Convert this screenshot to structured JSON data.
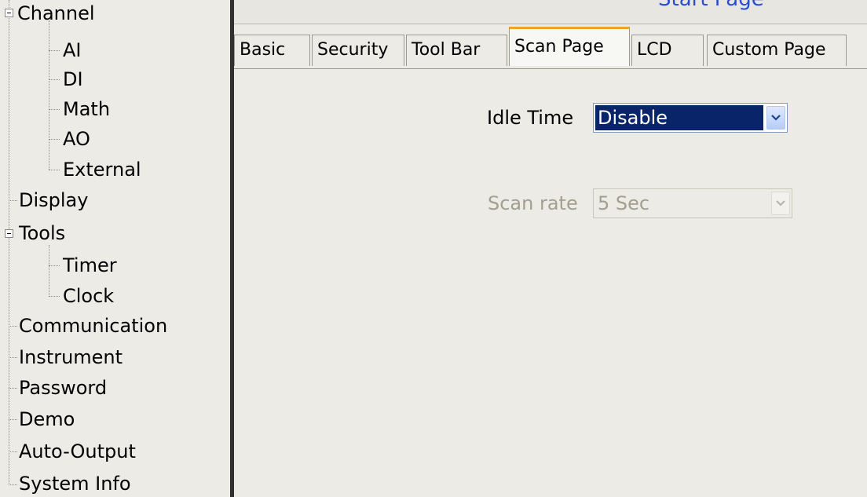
{
  "tree": {
    "items": [
      {
        "label": "Channel",
        "level": 0,
        "expanded": true
      },
      {
        "label": "AI",
        "level": 1
      },
      {
        "label": "DI",
        "level": 1
      },
      {
        "label": "Math",
        "level": 1
      },
      {
        "label": "AO",
        "level": 1
      },
      {
        "label": "External",
        "level": 1
      },
      {
        "label": "Display",
        "level": 0
      },
      {
        "label": "Tools",
        "level": 0,
        "expanded": true
      },
      {
        "label": "Timer",
        "level": 1
      },
      {
        "label": "Clock",
        "level": 1
      },
      {
        "label": "Communication",
        "level": 0
      },
      {
        "label": "Instrument",
        "level": 0
      },
      {
        "label": "Password",
        "level": 0
      },
      {
        "label": "Demo",
        "level": 0
      },
      {
        "label": "Auto-Output",
        "level": 0
      },
      {
        "label": "System Info",
        "level": 0
      }
    ]
  },
  "header": {
    "title": "Start Page"
  },
  "tabs": [
    {
      "label": "Basic"
    },
    {
      "label": "Security"
    },
    {
      "label": "Tool Bar"
    },
    {
      "label": "Scan Page",
      "active": true
    },
    {
      "label": "LCD"
    },
    {
      "label": "Custom Page"
    }
  ],
  "form": {
    "idle_time": {
      "label": "Idle Time",
      "value": "Disable",
      "enabled": true
    },
    "scan_rate": {
      "label": "Scan rate",
      "value": "5 Sec",
      "enabled": false
    }
  },
  "colors": {
    "selection": "#0a246a",
    "active_tab_accent": "#f0a32b",
    "header_text": "#2b4ccf"
  }
}
